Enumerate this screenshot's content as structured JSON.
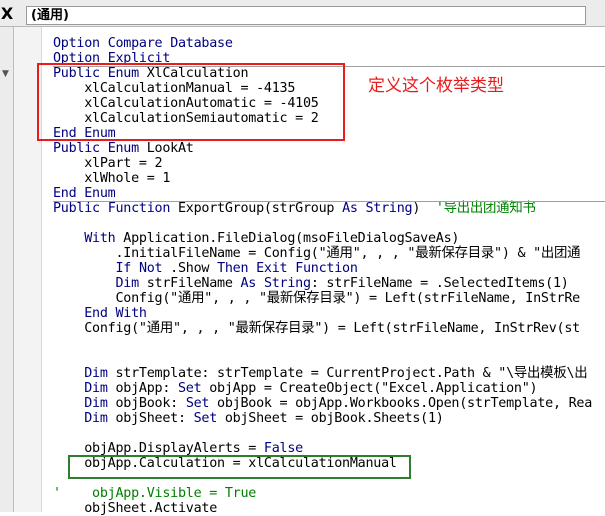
{
  "header": {
    "close_label": "X",
    "object_combo": "(通用)"
  },
  "toolbar": {
    "scroll_glyph": "▼"
  },
  "annotations": {
    "enum_note": "定义这个枚举类型"
  },
  "code": {
    "lines": [
      "Option Compare Database",
      "Option Explicit",
      "Public Enum XlCalculation",
      "    xlCalculationManual = -4135",
      "    xlCalculationAutomatic = -4105",
      "    xlCalculationSemiautomatic = 2",
      "End Enum",
      "Public Enum LookAt",
      "    xlPart = 2",
      "    xlWhole = 1",
      "End Enum",
      "Public Function ExportGroup(strGroup As String)  '导出出团通知书",
      "",
      "    With Application.FileDialog(msoFileDialogSaveAs)",
      "        .InitialFileName = Config(\"通用\", , , \"最新保存目录\") & \"出团通",
      "        If Not .Show Then Exit Function",
      "        Dim strFileName As String: strFileName = .SelectedItems(1)",
      "        Config(\"通用\", , , \"最新保存目录\") = Left(strFileName, InStrRe",
      "    End With",
      "    Config(\"通用\", , , \"最新保存目录\") = Left(strFileName, InStrRev(st",
      "",
      "",
      "    Dim strTemplate: strTemplate = CurrentProject.Path & \"\\导出模板\\出",
      "    Dim objApp: Set objApp = CreateObject(\"Excel.Application\")",
      "    Dim objBook: Set objBook = objApp.Workbooks.Open(strTemplate, Rea",
      "    Dim objSheet: Set objSheet = objBook.Sheets(1)",
      "",
      "    objApp.DisplayAlerts = False",
      "    objApp.Calculation = xlCalculationManual",
      "",
      "'    objApp.Visible = True",
      "    objSheet.Activate"
    ]
  }
}
